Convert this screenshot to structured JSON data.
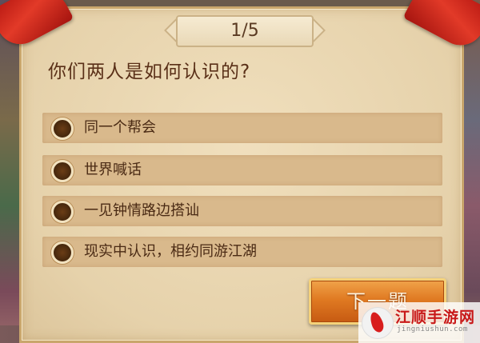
{
  "quiz": {
    "progress_text": "1/5",
    "progress": {
      "current": 1,
      "total": 5
    },
    "question": "你们两人是如何认识的?",
    "options": [
      {
        "label": "同一个帮会"
      },
      {
        "label": "世界喊话"
      },
      {
        "label": "一见钟情路边搭讪"
      },
      {
        "label": "现实中认识，相约同游江湖"
      }
    ],
    "next_label": "下一题"
  },
  "watermark": {
    "title": "江顺手游网",
    "subtitle": "jingniushun.com"
  },
  "colors": {
    "parchment": "#e9d7b3",
    "option_bg": "#d9b98c",
    "text_brown": "#5a3018",
    "button_orange": "#e07a22",
    "ribbon_red": "#d42a1e"
  }
}
